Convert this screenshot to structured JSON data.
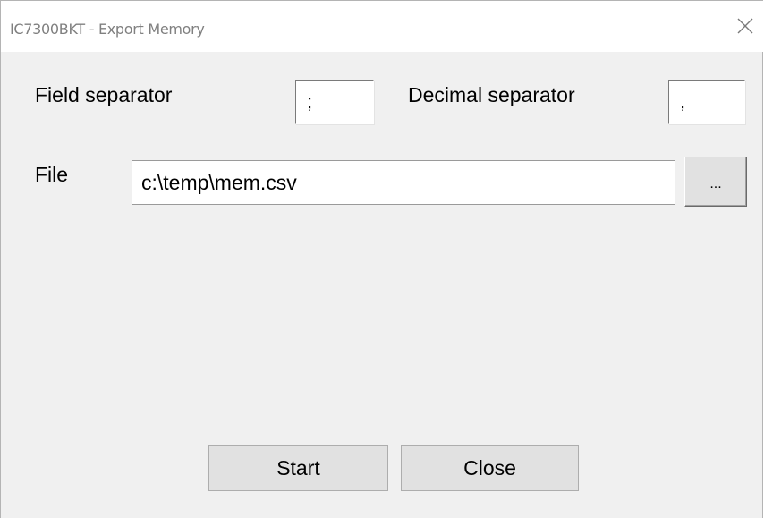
{
  "window": {
    "title": "IC7300BKT - Export Memory"
  },
  "form": {
    "field_separator_label": "Field separator",
    "field_separator_value": ";",
    "decimal_separator_label": "Decimal separator",
    "decimal_separator_value": ",",
    "file_label": "File",
    "file_value": "c:\\temp\\mem.csv",
    "browse_label": "..."
  },
  "actions": {
    "start_label": "Start",
    "close_label": "Close"
  },
  "icons": {
    "close": "close-icon"
  }
}
